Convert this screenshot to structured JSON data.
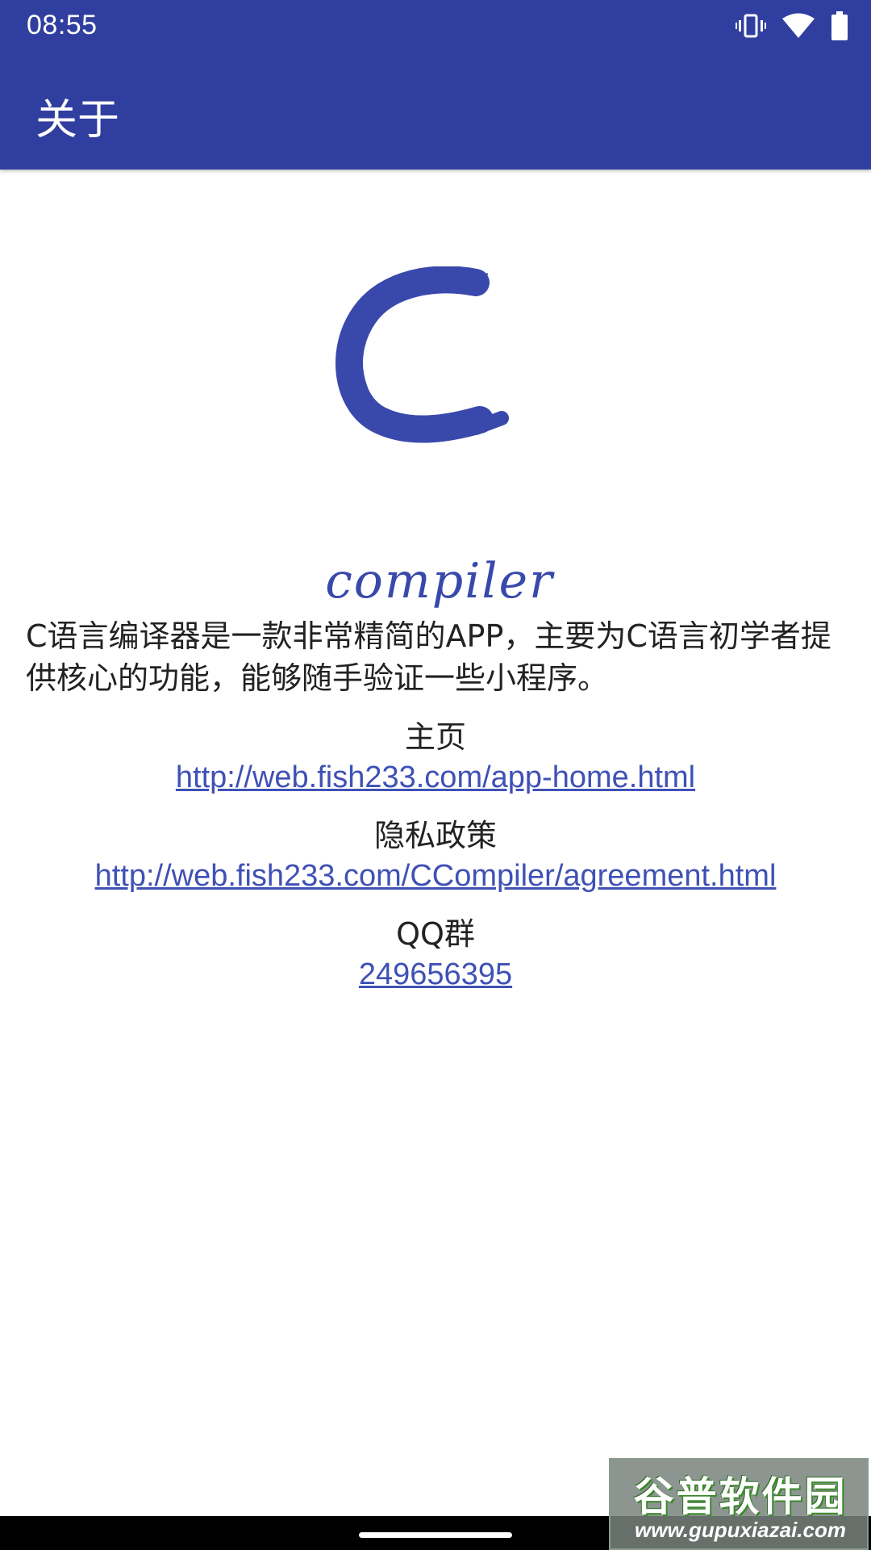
{
  "status_bar": {
    "time": "08:55",
    "icons": [
      "vibrate-icon",
      "wifi-icon",
      "battery-icon"
    ]
  },
  "app_bar": {
    "title": "关于",
    "color": "#303f9f"
  },
  "logo": {
    "letter": "C",
    "word": "compiler",
    "color": "#3949ab"
  },
  "description": "C语言编译器是一款非常精简的APP，主要为C语言初学者提供核心的功能，能够随手验证一些小程序。",
  "home": {
    "label": "主页",
    "link": "http://web.fish233.com/app-home.html"
  },
  "privacy": {
    "label": "隐私政策",
    "link": "http://web.fish233.com/CCompiler/agreement.html"
  },
  "qq": {
    "label": "QQ群",
    "link": "249656395"
  },
  "link_color": "#3f51b5",
  "watermark": {
    "title": "谷普软件园",
    "url": "www.gupuxiazai.com"
  }
}
